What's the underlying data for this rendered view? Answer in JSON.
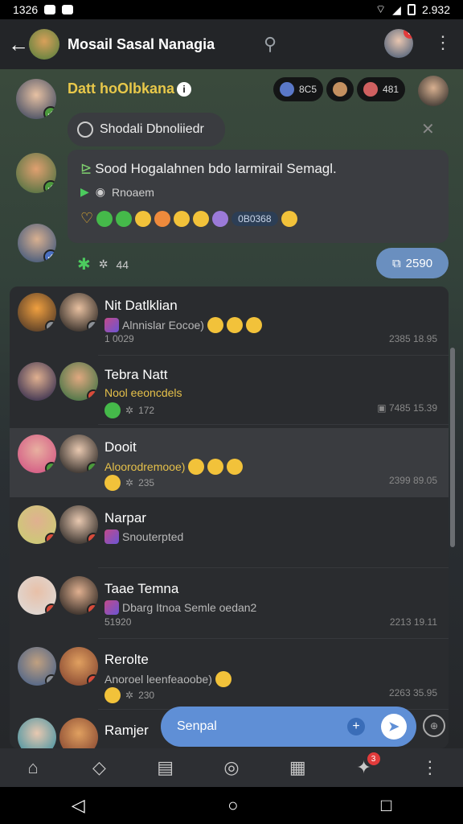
{
  "status": {
    "time": "1326",
    "battery": "2.932"
  },
  "header": {
    "title": "Mosail Sasal Nanagia",
    "notif_count": "6"
  },
  "pinned": {
    "sender": "Datt hoOlbkana",
    "chips": [
      "8C5",
      "481"
    ],
    "reply_label": "Shodali Dbnoliiedr",
    "message": "Sood Hogalahnen bdo larmirail Semagl.",
    "voice_label": "Rnoaem",
    "reaction_count": "0B0368",
    "react_text": "44",
    "count_pill": "2590"
  },
  "threads": [
    {
      "name": "Nit Datlklian",
      "sub": "Alnnislar Eocoe)",
      "meta": "1 0029",
      "time": "2385 18.95"
    },
    {
      "name": "Tebra Natt",
      "sub": "Nool eeoncdels",
      "meta": "172",
      "time": "7485 15.39"
    },
    {
      "name": "Dooit",
      "sub": "Aloorodremooe)",
      "meta": "235",
      "time": "2399 89.05"
    },
    {
      "name": "Narpar",
      "sub": "Snouterpted",
      "meta": "",
      "time": ""
    },
    {
      "name": "Taae Temna",
      "sub": "Dbarg Itnoa Semle oedan2",
      "meta": "51920",
      "time": "2213 19.11"
    },
    {
      "name": "Rerolte",
      "sub": "Anoroel leenfeaoobe)",
      "meta": "230",
      "time": "2263 35.95"
    },
    {
      "name": "Ramjer",
      "sub": "",
      "meta": "",
      "time": ""
    }
  ],
  "compose": {
    "placeholder": "Senpal"
  }
}
